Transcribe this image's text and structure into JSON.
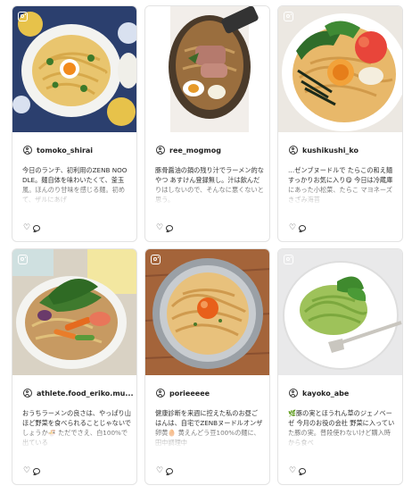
{
  "posts": [
    {
      "username": "tomoko_shirai",
      "caption": "今日のランチ、初利用のZENB NOODLE。麺自体を味わいたくて、釜玉風。ほんのり甘味を感じる麺。初めて、ザルにあげ",
      "image": "pasta-with-egg-and-greens",
      "icons": {
        "source": "instagram-icon",
        "user": "user-icon",
        "like": "heart-icon",
        "comment": "comment-icon"
      }
    },
    {
      "username": "ree_mogmog",
      "caption": "豚骨醤油の鍋の残り汁でラーメン的なやつ あすけん登録無し。汁は飲んだりはしないので、そんなに悪くないと思う。",
      "image": "ramen-in-pot",
      "icons": {
        "source": "instagram-icon",
        "user": "user-icon",
        "like": "heart-icon",
        "comment": "comment-icon"
      }
    },
    {
      "username": "kushikushi_ko",
      "caption": "…ゼンブヌードルで たらこの和え麺 すっかりお気に入り😋 今日は冷蔵庫にあった小松菜、たらこ マヨネーズ きざみ海苔",
      "image": "tarako-noodles",
      "icons": {
        "source": "instagram-icon",
        "user": "user-icon",
        "like": "heart-icon",
        "comment": "comment-icon"
      }
    },
    {
      "username": "athlete.food_eriko.mu...",
      "caption": "おうちラーメンの良さは、やっぱり山ほど野菜を食べられることじゃないでしょうか🍜 ただでさえ、白100%で出ている",
      "image": "vegetable-ramen",
      "icons": {
        "source": "instagram-icon",
        "user": "user-icon",
        "like": "heart-icon",
        "comment": "comment-icon"
      }
    },
    {
      "username": "porieeeee",
      "caption": "健康診断を来週に控えた私のお昼ごはんは、自宅でZENBヌードルオンザ卵黄🥚 黄えんどう豆100%の麺に、田中調理中",
      "image": "noodles-with-yolk",
      "icons": {
        "source": "instagram-icon",
        "user": "user-icon",
        "like": "heart-icon",
        "comment": "comment-icon"
      }
    },
    {
      "username": "kayoko_abe",
      "caption": "🌿豚の実とほうれん草のジェノベーゼ 今月のお役の会社 野菜に入っていた豚の実。普段使わないけど購入時から食べ",
      "image": "genovese-pasta",
      "icons": {
        "source": "instagram-icon",
        "user": "user-icon",
        "like": "heart-icon",
        "comment": "comment-icon"
      }
    }
  ]
}
